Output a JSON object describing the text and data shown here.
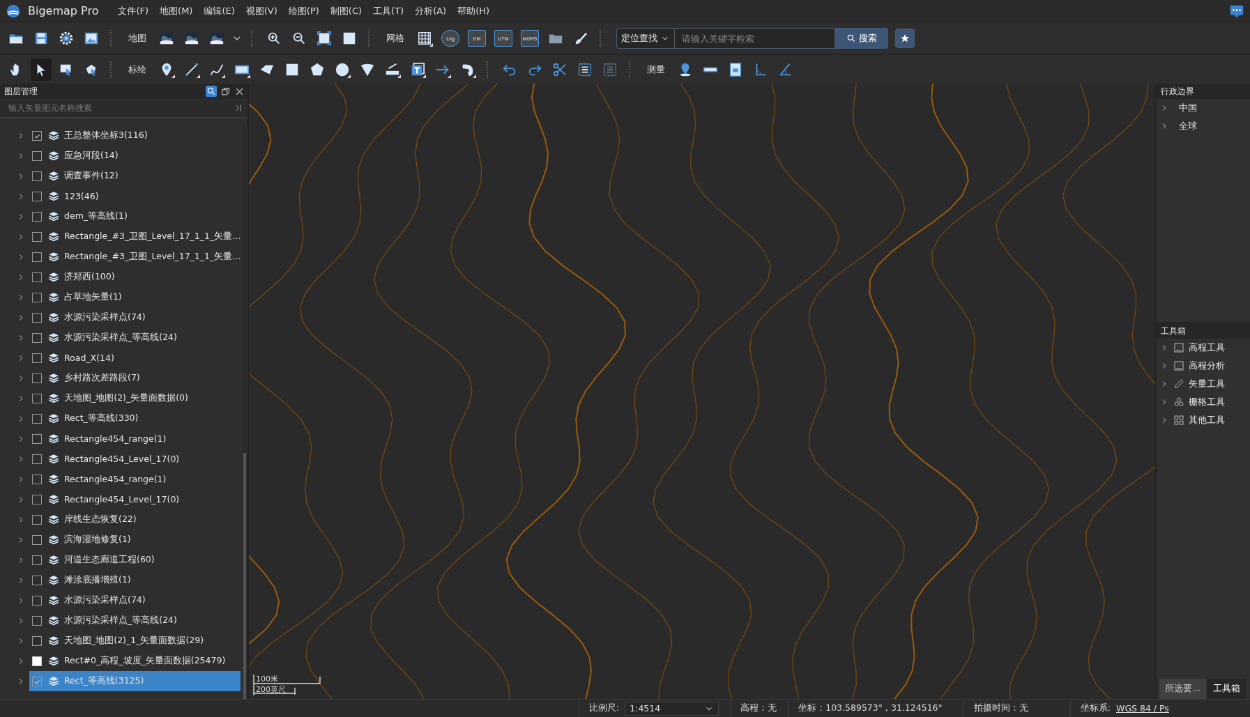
{
  "app": {
    "title": "Bigemap Pro"
  },
  "menu": [
    "文件(F)",
    "地图(M)",
    "编辑(E)",
    "视图(V)",
    "绘图(P)",
    "制图(C)",
    "工具(T)",
    "分析(A)",
    "帮助(H)"
  ],
  "toolbar_1": {
    "map_label": "地图",
    "grid_label": "网格",
    "grid_buttons": [
      "Lng",
      "KM",
      "UTM",
      "MGRS"
    ],
    "locate": {
      "mode": "定位查找",
      "placeholder": "请输入关键字检索",
      "search_button": "搜索"
    }
  },
  "toolbar_2": {
    "select_tools": [
      {
        "selected": false
      },
      {
        "selected": true
      },
      {
        "selected": false
      },
      {
        "selected": false
      }
    ],
    "plot_label": "标绘",
    "measure_label": "测量"
  },
  "layer_panel": {
    "title": "图层管理",
    "search_placeholder": "输入矢量图元名称搜索",
    "layers": [
      {
        "label": "王总整体坐标3(116)",
        "checked": true,
        "partial": false,
        "selected": false
      },
      {
        "label": "应急河段(14)",
        "checked": false,
        "partial": false,
        "selected": false
      },
      {
        "label": "调查事件(12)",
        "checked": false,
        "partial": false,
        "selected": false
      },
      {
        "label": "123(46)",
        "checked": false,
        "partial": false,
        "selected": false
      },
      {
        "label": "dem_等高线(1)",
        "checked": false,
        "partial": false,
        "selected": false
      },
      {
        "label": "Rectangle_#3_卫图_Level_17_1_1_矢量...",
        "checked": false,
        "partial": false,
        "selected": false
      },
      {
        "label": "Rectangle_#3_卫图_Level_17_1_1_矢量...",
        "checked": false,
        "partial": false,
        "selected": false
      },
      {
        "label": "济郑西(100)",
        "checked": false,
        "partial": false,
        "selected": false
      },
      {
        "label": "占草地矢量(1)",
        "checked": false,
        "partial": false,
        "selected": false
      },
      {
        "label": "水源污染采样点(74)",
        "checked": false,
        "partial": false,
        "selected": false
      },
      {
        "label": "水源污染采样点_等高线(24)",
        "checked": false,
        "partial": false,
        "selected": false
      },
      {
        "label": "Road_X(14)",
        "checked": false,
        "partial": false,
        "selected": false
      },
      {
        "label": "乡村路次差路段(7)",
        "checked": false,
        "partial": false,
        "selected": false
      },
      {
        "label": "天地图_地图(2)_矢量面数据(0)",
        "checked": false,
        "partial": false,
        "selected": false
      },
      {
        "label": "Rect_等高线(330)",
        "checked": false,
        "partial": false,
        "selected": false
      },
      {
        "label": "Rectangle454_range(1)",
        "checked": false,
        "partial": false,
        "selected": false
      },
      {
        "label": "Rectangle454_Level_17(0)",
        "checked": false,
        "partial": false,
        "selected": false
      },
      {
        "label": "Rectangle454_range(1)",
        "checked": false,
        "partial": false,
        "selected": false
      },
      {
        "label": "Rectangle454_Level_17(0)",
        "checked": false,
        "partial": false,
        "selected": false
      },
      {
        "label": "岸线生态恢复(22)",
        "checked": false,
        "partial": false,
        "selected": false
      },
      {
        "label": "滨海湿地修复(1)",
        "checked": false,
        "partial": false,
        "selected": false
      },
      {
        "label": "河道生态廊道工程(60)",
        "checked": false,
        "partial": false,
        "selected": false
      },
      {
        "label": "滩涂底播增殖(1)",
        "checked": false,
        "partial": false,
        "selected": false
      },
      {
        "label": "水源污染采样点(74)",
        "checked": false,
        "partial": false,
        "selected": false
      },
      {
        "label": "水源污染采样点_等高线(24)",
        "checked": false,
        "partial": false,
        "selected": false
      },
      {
        "label": "天地图_地图(2)_1_矢量面数据(29)",
        "checked": false,
        "partial": false,
        "selected": false
      },
      {
        "label": "Rect#0_高程_坡度_矢量面数据(25479)",
        "checked": false,
        "partial": true,
        "selected": false
      },
      {
        "label": "Rect_等高线(3125)",
        "checked": true,
        "partial": false,
        "selected": true
      }
    ]
  },
  "map": {
    "kind": "picture",
    "scale_bar": {
      "metric": "100米",
      "imperial": "200英尺"
    }
  },
  "admin_panel": {
    "title": "行政边界",
    "items": [
      "中国",
      "全球"
    ]
  },
  "toolbox": {
    "title": "工具箱",
    "items": [
      {
        "label": "高程工具",
        "kind": "elevation"
      },
      {
        "label": "高程分析",
        "kind": "elevation"
      },
      {
        "label": "矢量工具",
        "kind": "pencil"
      },
      {
        "label": "栅格工具",
        "kind": "raster"
      },
      {
        "label": "其他工具",
        "kind": "grid"
      }
    ]
  },
  "bottom_tabs": [
    {
      "label": "所选要...",
      "selected": false
    },
    {
      "label": "工具箱",
      "selected": true
    }
  ],
  "status_bar": {
    "scale_label": "比例尺:",
    "scale_value": "1:4514",
    "elevation": "高程：无",
    "coordinates": "坐标：103.589573° , 31.124516°",
    "capture_time": "拍摄时间：无",
    "crs_label": "坐标系:",
    "crs_value": "WGS 84 / Ps"
  }
}
